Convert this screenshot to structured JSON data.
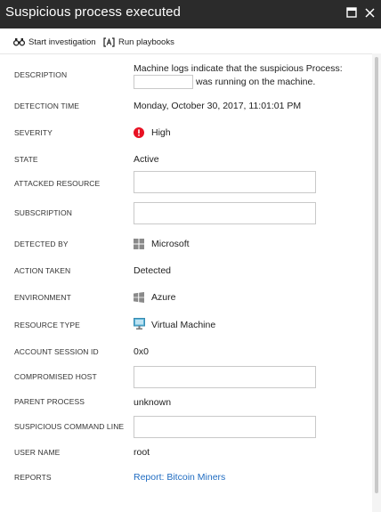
{
  "window": {
    "title": "Suspicious process executed",
    "maximize_icon": "maximize-icon",
    "close_icon": "close-icon"
  },
  "toolbar": {
    "start_investigation": "Start investigation",
    "run_playbooks": "Run playbooks"
  },
  "fields": {
    "description": {
      "label": "DESCRIPTION",
      "line1": "Machine logs indicate that the suspicious Process:",
      "line2": "was running on the machine."
    },
    "detection_time": {
      "label": "DETECTION TIME",
      "value": "Monday, October 30, 2017, 11:01:01 PM"
    },
    "severity": {
      "label": "SEVERITY",
      "value": "High",
      "icon": "error-icon",
      "color": "#e81123"
    },
    "state": {
      "label": "STATE",
      "value": "Active"
    },
    "attacked_resource": {
      "label": "ATTACKED RESOURCE"
    },
    "subscription": {
      "label": "SUBSCRIPTION"
    },
    "detected_by": {
      "label": "DETECTED BY",
      "value": "Microsoft",
      "icon": "windows-logo-icon"
    },
    "action_taken": {
      "label": "ACTION TAKEN",
      "value": "Detected"
    },
    "environment": {
      "label": "ENVIRONMENT",
      "value": "Azure",
      "icon": "windows-logo-icon"
    },
    "resource_type": {
      "label": "RESOURCE TYPE",
      "value": "Virtual Machine",
      "icon": "virtual-machine-icon"
    },
    "account_session_id": {
      "label": "ACCOUNT SESSION ID",
      "value": "0x0"
    },
    "compromised_host": {
      "label": "COMPROMISED HOST"
    },
    "parent_process": {
      "label": "PARENT PROCESS",
      "value": "unknown"
    },
    "suspicious_command_line": {
      "label": "SUSPICIOUS COMMAND LINE"
    },
    "user_name": {
      "label": "USER NAME",
      "value": "root"
    },
    "reports": {
      "label": "REPORTS",
      "value": "Report: Bitcoin Miners",
      "link_color": "#1e6bc1"
    }
  },
  "colors": {
    "titlebar_bg": "#2b2b2b",
    "accent_link": "#1e6bc1",
    "severity_high": "#e81123"
  }
}
